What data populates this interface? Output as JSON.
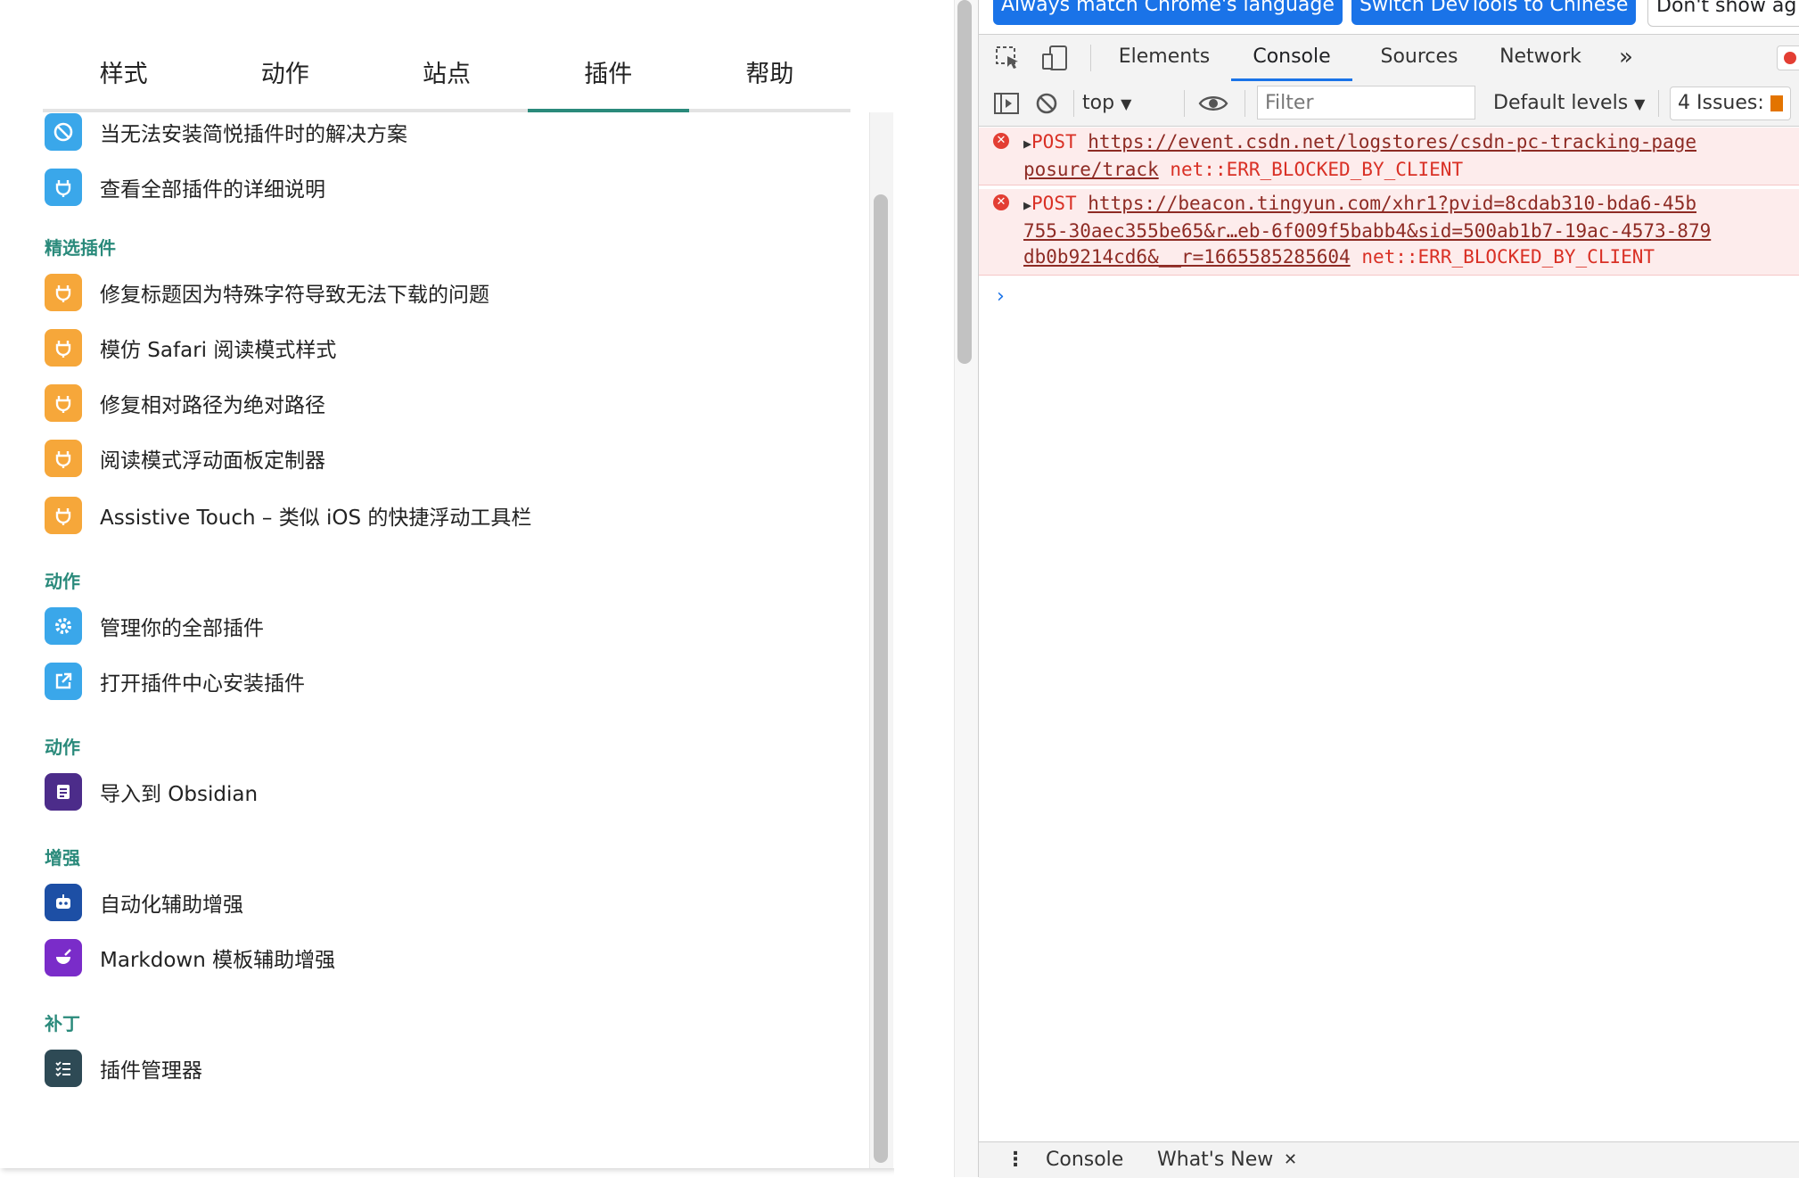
{
  "popup": {
    "tabs": [
      {
        "label": "样式"
      },
      {
        "label": "动作"
      },
      {
        "label": "站点"
      },
      {
        "label": "插件",
        "active": true
      },
      {
        "label": "帮助"
      }
    ],
    "items": {
      "fix_install": "当无法安装简悦插件时的解决方案",
      "view_all": "查看全部插件的详细说明",
      "featured_title": "精选插件",
      "fix_title": "修复标题因为特殊字符导致无法下载的问题",
      "safari_style": "模仿 Safari 阅读模式样式",
      "fix_paths": "修复相对路径为绝对路径",
      "float_panel": "阅读模式浮动面板定制器",
      "assistive_touch": "Assistive Touch – 类似 iOS 的快捷浮动工具栏",
      "actions_title": "动作",
      "manage_all": "管理你的全部插件",
      "open_center": "打开插件中心安装插件",
      "actions2_title": "动作",
      "import_obsidian": "导入到 Obsidian",
      "enhance_title": "增强",
      "automation": "自动化辅助增强",
      "markdown_template": "Markdown 模板辅助增强",
      "patch_title": "补丁",
      "plugin_manager": "插件管理器"
    },
    "colors": {
      "accent": "#2a8a7b",
      "blue_icon": "#3aa7ea",
      "orange_icon": "#f6a73a",
      "obsidian_icon": "#4c2c8a",
      "robot_icon": "#1d4fa5",
      "markdown_icon": "#7a2cc9",
      "manager_icon": "#2e4a55"
    }
  },
  "devtools": {
    "infobar": {
      "match_language": "Always match Chrome's language",
      "switch_chinese": "Switch DevTools to Chinese",
      "dont_show": "Don't show ag"
    },
    "tabs": [
      "Elements",
      "Console",
      "Sources",
      "Network"
    ],
    "active_tab": "Console",
    "more_tabs": "»",
    "toolbar": {
      "context": "top",
      "filter_placeholder": "Filter",
      "levels": "Default levels",
      "issues": "4 Issues:"
    },
    "messages": [
      {
        "method": "POST",
        "url_line1": "https://event.csdn.net/logstores/csdn-pc-tracking-page",
        "url_line2": "posure/track",
        "error": "net::ERR_BLOCKED_BY_CLIENT"
      },
      {
        "method": "POST",
        "url_line1": "https://beacon.tingyun.com/xhr1?pvid=8cdab310-bda6-45b",
        "url_line2": "755-30aec355be65&r…eb-6f009f5babb4&sid=500ab1b7-19ac-4573-879",
        "url_line3": "db0b9214cd6&__r=1665585285604",
        "error": "net::ERR_BLOCKED_BY_CLIENT"
      }
    ],
    "prompt": "›",
    "drawer": {
      "console": "Console",
      "whats_new": "What's New",
      "close": "✕"
    }
  }
}
